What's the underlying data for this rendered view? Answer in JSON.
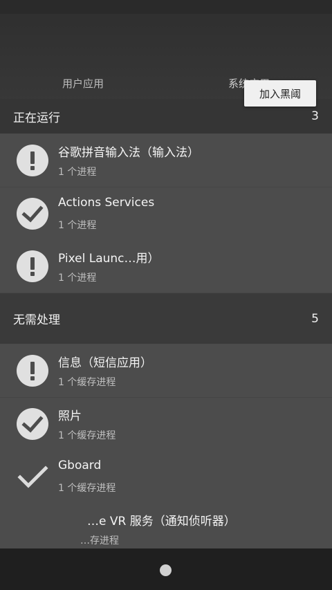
{
  "tabs": {
    "user_apps": "用户应用",
    "system_apps": "系统应用"
  },
  "tooltip": "加入黑阈",
  "sections": [
    {
      "title": "正在运行",
      "count": "3",
      "items": [
        {
          "name": "谷歌拼音输入法（输入法）",
          "sub": "1 个进程",
          "icon": "exclamation-circle-icon"
        },
        {
          "name": "Actions Services",
          "sub": "1 个进程",
          "icon": "check-circle-icon"
        },
        {
          "name": "Pixel Launc…用）",
          "sub": "1 个进程",
          "icon": "exclamation-circle-icon"
        }
      ]
    },
    {
      "title": "无需处理",
      "count": "5",
      "items": [
        {
          "name": "信息（短信应用）",
          "sub": "1 个缓存进程",
          "icon": "exclamation-circle-icon"
        },
        {
          "name": "照片",
          "sub": "1 个缓存进程",
          "icon": "check-circle-icon"
        },
        {
          "name": "Gboard",
          "sub": "1 个缓存进程",
          "icon": "check-icon"
        },
        {
          "name": "…e VR 服务（通知侦听器）",
          "sub": "…存进程",
          "icon": "none"
        }
      ]
    }
  ],
  "colors": {
    "tab_indicator": "#4f86c6",
    "icon_fill": "#e0e0e0"
  }
}
